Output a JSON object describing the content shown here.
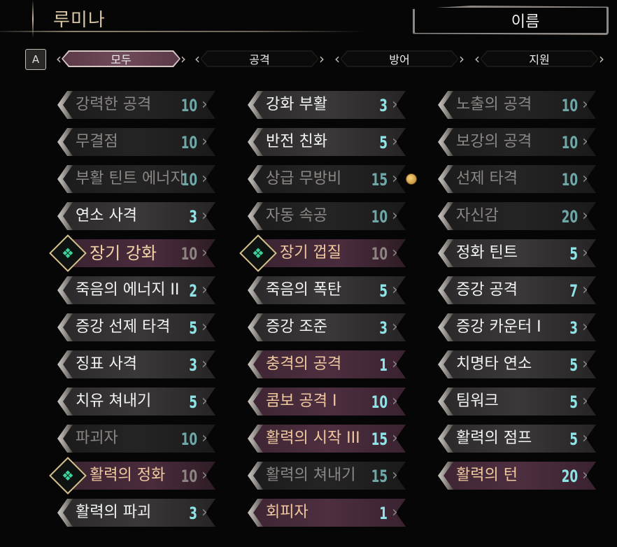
{
  "header": {
    "character_name": "루미나",
    "sort_label": "이름"
  },
  "filters": {
    "key_hint": "A",
    "tabs": [
      {
        "label": "모두",
        "active": true
      },
      {
        "label": "공격",
        "active": false
      },
      {
        "label": "방어",
        "active": false
      },
      {
        "label": "지원",
        "active": false
      }
    ]
  },
  "colors": {
    "cost_cyan": "#8fe3e6",
    "equipped_pink": "#4d2f40",
    "unavailable_text": "#8a8785",
    "special_gold": "#d8c08c"
  },
  "skills": {
    "col1": [
      {
        "name": "강력한 공격",
        "cost": "10",
        "state": "dim"
      },
      {
        "name": "무결점",
        "cost": "10",
        "state": "dim"
      },
      {
        "name": "부활 틴트 에너지",
        "cost": "10",
        "state": "dim"
      },
      {
        "name": "연소 사격",
        "cost": "3",
        "state": "normal"
      },
      {
        "name": "장기 강화",
        "cost": "10",
        "state": "special",
        "icon": "special-skill-emblem-icon"
      },
      {
        "name": "죽음의 에너지 II",
        "cost": "2",
        "state": "normal"
      },
      {
        "name": "증강 선제 타격",
        "cost": "5",
        "state": "normal"
      },
      {
        "name": "징표 사격",
        "cost": "3",
        "state": "normal"
      },
      {
        "name": "치유 쳐내기",
        "cost": "5",
        "state": "normal"
      },
      {
        "name": "파괴자",
        "cost": "10",
        "state": "dim"
      },
      {
        "name": "활력의 정화",
        "cost": "10",
        "state": "pinkdim",
        "icon": "special-skill-emblem-icon"
      },
      {
        "name": "활력의 파괴",
        "cost": "3",
        "state": "normal"
      }
    ],
    "col2": [
      {
        "name": "강화 부활",
        "cost": "3",
        "state": "normal"
      },
      {
        "name": "반전 친화",
        "cost": "5",
        "state": "normal"
      },
      {
        "name": "상급 무방비",
        "cost": "15",
        "state": "dim",
        "badge": "coin-icon"
      },
      {
        "name": "자동 속공",
        "cost": "10",
        "state": "dim"
      },
      {
        "name": "장기 껍질",
        "cost": "10",
        "state": "pinkdim",
        "icon": "special-skill-emblem-icon"
      },
      {
        "name": "죽음의 폭탄",
        "cost": "5",
        "state": "normal"
      },
      {
        "name": "증강 조준",
        "cost": "3",
        "state": "normal"
      },
      {
        "name": "충격의 공격",
        "cost": "1",
        "state": "pink"
      },
      {
        "name": "콤보 공격 I",
        "cost": "10",
        "state": "pink"
      },
      {
        "name": "활력의 시작 III",
        "cost": "15",
        "state": "pink"
      },
      {
        "name": "활력의 쳐내기",
        "cost": "15",
        "state": "dim"
      },
      {
        "name": "회피자",
        "cost": "1",
        "state": "pink"
      }
    ],
    "col3": [
      {
        "name": "노출의 공격",
        "cost": "10",
        "state": "dim"
      },
      {
        "name": "보강의 공격",
        "cost": "10",
        "state": "dim"
      },
      {
        "name": "선제 타격",
        "cost": "10",
        "state": "dim"
      },
      {
        "name": "자신감",
        "cost": "20",
        "state": "dim"
      },
      {
        "name": "정화 틴트",
        "cost": "5",
        "state": "normal"
      },
      {
        "name": "증강 공격",
        "cost": "7",
        "state": "normal"
      },
      {
        "name": "증강 카운터 I",
        "cost": "3",
        "state": "normal"
      },
      {
        "name": "치명타 연소",
        "cost": "5",
        "state": "normal"
      },
      {
        "name": "팀워크",
        "cost": "5",
        "state": "normal"
      },
      {
        "name": "활력의 점프",
        "cost": "5",
        "state": "normal"
      },
      {
        "name": "활력의 턴",
        "cost": "20",
        "state": "pink"
      }
    ]
  }
}
